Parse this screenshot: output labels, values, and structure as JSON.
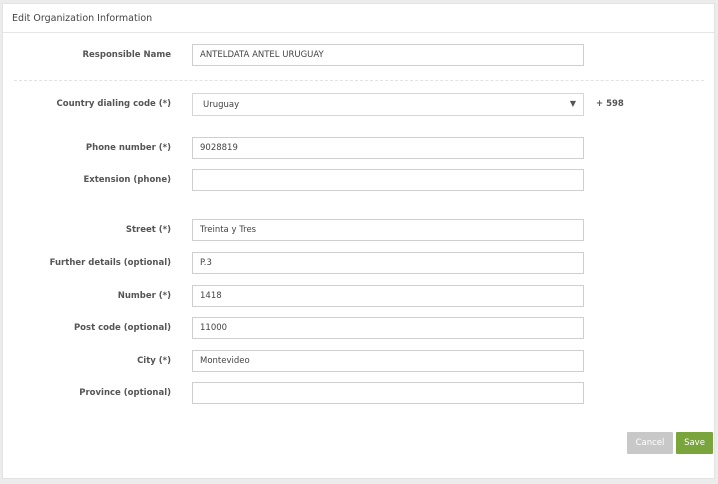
{
  "header": {
    "title": "Edit Organization Information"
  },
  "form": {
    "responsible_name": {
      "label": "Responsible Name",
      "value": "ANTELDATA ANTEL URUGUAY"
    },
    "country_dialing": {
      "label": "Country dialing code (*)",
      "value": "Uruguay",
      "dial_code": "+ 598"
    },
    "phone_number": {
      "label": "Phone number (*)",
      "value": "9028819"
    },
    "extension": {
      "label": "Extension (phone)",
      "value": ""
    },
    "street": {
      "label": "Street (*)",
      "value": "Treinta y Tres"
    },
    "further_details": {
      "label": "Further details (optional)",
      "value": "P.3"
    },
    "number": {
      "label": "Number (*)",
      "value": "1418"
    },
    "post_code": {
      "label": "Post code (optional)",
      "value": "11000"
    },
    "city": {
      "label": "City (*)",
      "value": "Montevideo"
    },
    "province": {
      "label": "Province (optional)",
      "value": ""
    }
  },
  "actions": {
    "cancel_label": "Cancel",
    "save_label": "Save"
  },
  "colors": {
    "save": "#7aa53c",
    "cancel": "#c8c8c8"
  }
}
